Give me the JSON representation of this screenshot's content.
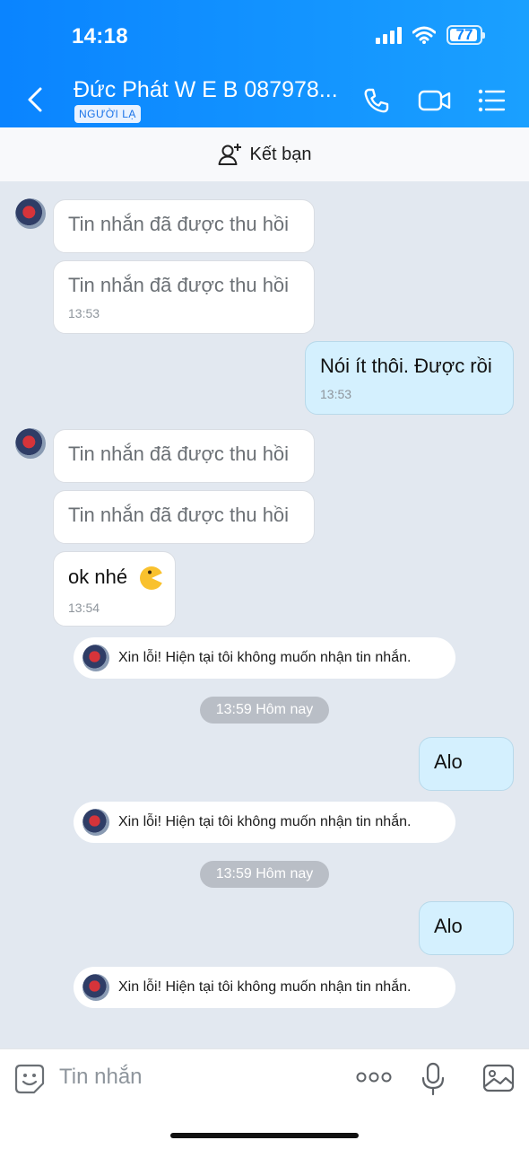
{
  "status_bar": {
    "time": "14:18",
    "battery": "77"
  },
  "header": {
    "title": "Đức Phát W E B 087978...",
    "badge": "NGƯỜI LẠ"
  },
  "friend_bar": {
    "label": "Kết bạn"
  },
  "messages": [
    {
      "text": "Tin nhắn đã được thu hồi"
    },
    {
      "text": "Tin nhắn đã được thu hồi",
      "time": "13:53"
    },
    {
      "text": "Nói ít thôi. Được rồi",
      "time": "13:53"
    },
    {
      "text": "Tin nhắn đã được thu hồi"
    },
    {
      "text": "Tin nhắn đã được thu hồi"
    },
    {
      "text": "ok nhé",
      "time": "13:54"
    },
    {
      "text": "Alo"
    },
    {
      "text": "Alo"
    }
  ],
  "system_message": "Xin lỗi! Hiện tại tôi không muốn nhận tin nhắn.",
  "time_chip": "13:59 Hôm nay",
  "composer": {
    "placeholder": "Tin nhắn"
  },
  "colors": {
    "header": "#0a84ff",
    "outgoing_bubble": "#d4f0fe",
    "background": "#e2e8f0"
  },
  "icons": [
    "back-icon",
    "phone-icon",
    "video-call-icon",
    "menu-list-icon",
    "add-friend-icon",
    "sticker-icon",
    "more-icon",
    "microphone-icon",
    "image-icon",
    "emoji-icon"
  ]
}
